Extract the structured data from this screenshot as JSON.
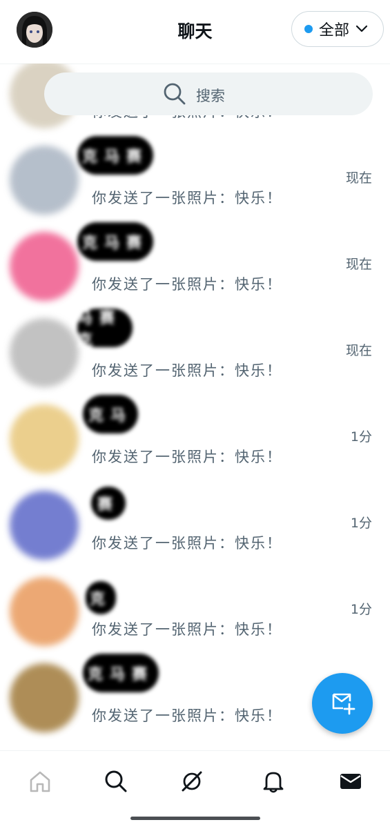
{
  "header": {
    "title": "聊天",
    "filter_label": "全部"
  },
  "search": {
    "placeholder": "搜索"
  },
  "conversations": [
    {
      "name": "",
      "time": "",
      "preview": "你发送了一张照片：快乐！",
      "avatar_color": "#d9d2c4"
    },
    {
      "name": "克马赛",
      "time": "现在",
      "preview": "你发送了一张照片：快乐！",
      "avatar_color": "#a9b4c2"
    },
    {
      "name": "克马赛",
      "time": "现在",
      "preview": "你发送了一张照片：快乐！",
      "avatar_color": "#ef5a8c"
    },
    {
      "name": "马赛克",
      "time": "现在",
      "preview": "你发送了一张照片：快乐！",
      "avatar_color": "#b8b8b8"
    },
    {
      "name": "克马",
      "time": "1分",
      "preview": "你发送了一张照片：快乐！",
      "avatar_color": "#e8c77a"
    },
    {
      "name": "赛",
      "time": "1分",
      "preview": "你发送了一张照片：快乐！",
      "avatar_color": "#5c68c8"
    },
    {
      "name": "克",
      "time": "1分",
      "preview": "你发送了一张照片：快乐！",
      "avatar_color": "#e99a5c"
    },
    {
      "name": "克马赛",
      "time": "",
      "preview": "你发送了一张照片：快乐！",
      "avatar_color": "#a07a3a"
    }
  ],
  "colors": {
    "accent": "#1d9bf0",
    "text_primary": "#0f1419",
    "text_secondary": "#536471"
  },
  "bottom_nav": {
    "items": [
      "home-icon",
      "search-icon",
      "spaces-icon",
      "bell-icon",
      "mail-icon"
    ],
    "active": "mail-icon"
  },
  "fab_icon": "new-message-icon"
}
